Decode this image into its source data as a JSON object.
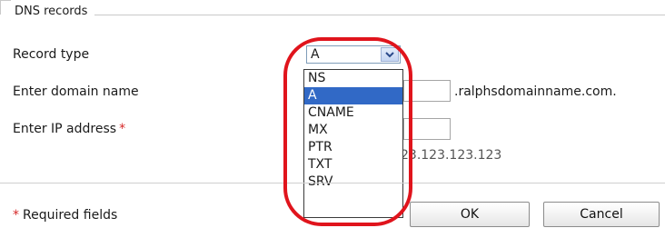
{
  "fieldset": {
    "legend": "DNS records"
  },
  "form": {
    "record_type_label": "Record type",
    "domain_label": "Enter domain name",
    "ip_label": "Enter IP address",
    "required_marker": "*",
    "record_type_value": "A",
    "domain_suffix": ".ralphsdomainname.com.",
    "ip_hint": "23.123.123.123"
  },
  "dropdown": {
    "options": [
      "NS",
      "A",
      "CNAME",
      "MX",
      "PTR",
      "TXT",
      "SRV"
    ],
    "selected": "A"
  },
  "footer": {
    "required_note": "Required fields",
    "ok_label": "OK",
    "cancel_label": "Cancel"
  },
  "icons": {
    "select_arrow": "chevron-down-icon"
  },
  "colors": {
    "highlight": "#3169c6",
    "annotation_oval": "#e0141c",
    "required_star": "#d62828"
  }
}
